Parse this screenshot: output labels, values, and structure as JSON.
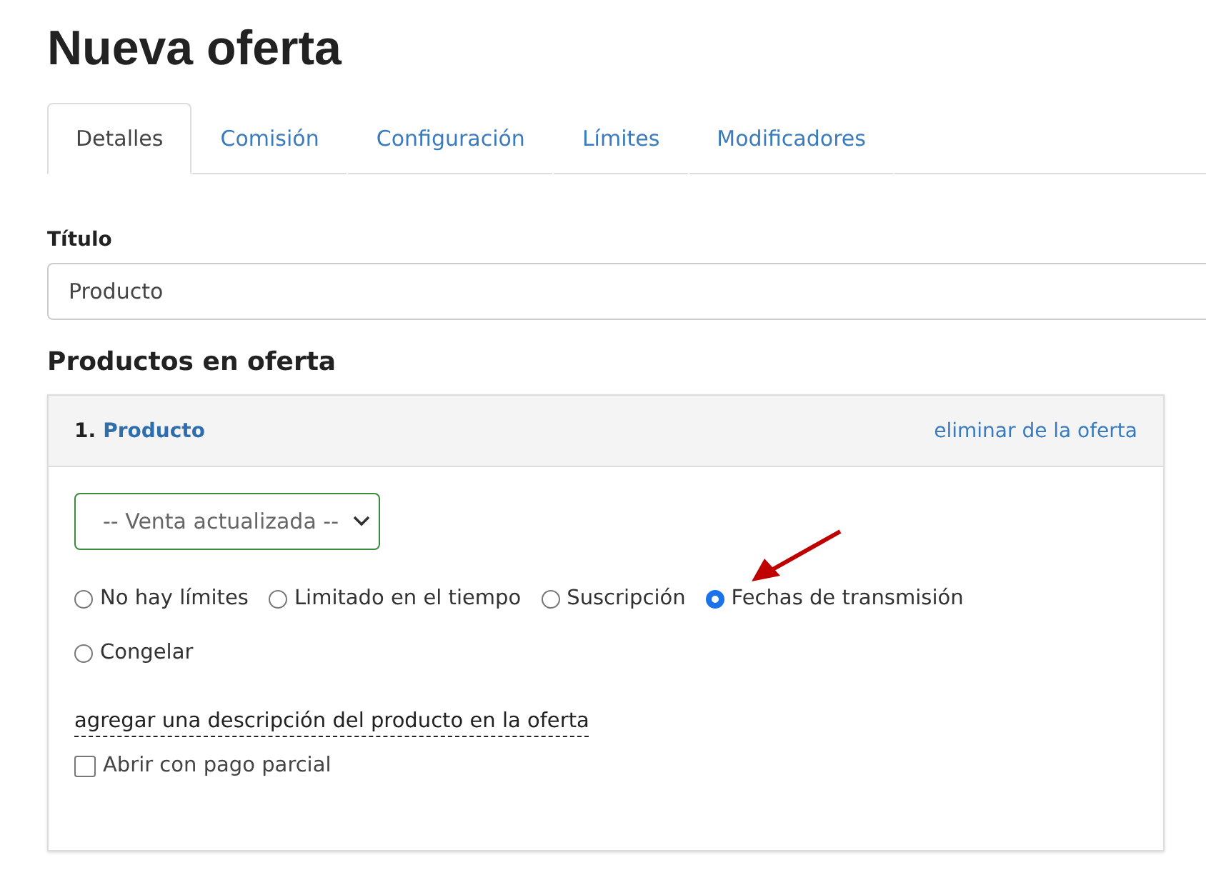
{
  "page_title": "Nueva oferta",
  "tabs": [
    {
      "label": "Detalles",
      "selected": true
    },
    {
      "label": "Comisión",
      "selected": false
    },
    {
      "label": "Configuración",
      "selected": false
    },
    {
      "label": "Límites",
      "selected": false
    },
    {
      "label": "Modificadores",
      "selected": false
    }
  ],
  "title_field": {
    "label": "Título",
    "value": "Producto"
  },
  "section_heading": "Productos en oferta",
  "product": {
    "number": "1.",
    "name": "Producto",
    "remove_link": "eliminar de la oferta",
    "select_value": "-- Venta actualizada --",
    "options": [
      {
        "label": "No hay límites",
        "selected": false
      },
      {
        "label": "Limitado en el tiempo",
        "selected": false
      },
      {
        "label": "Suscripción",
        "selected": false
      },
      {
        "label": "Fechas de transmisión",
        "selected": true
      },
      {
        "label": "Congelar",
        "selected": false
      }
    ],
    "description_link": "agregar una descripción del producto en la oferta",
    "partial_payment": {
      "label": "Abrir con pago parcial",
      "checked": false
    }
  }
}
